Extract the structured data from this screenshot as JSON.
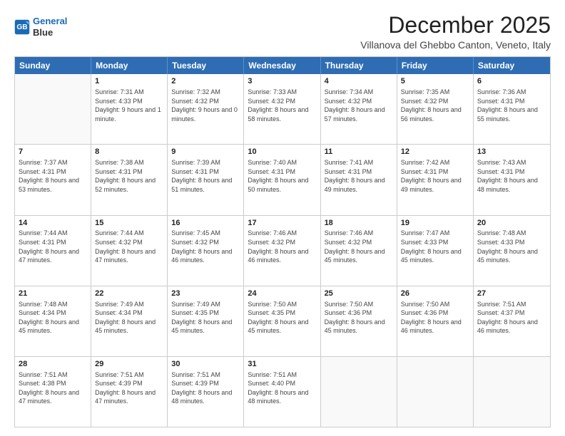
{
  "logo": {
    "line1": "General",
    "line2": "Blue"
  },
  "title": "December 2025",
  "location": "Villanova del Ghebbo Canton, Veneto, Italy",
  "header_days": [
    "Sunday",
    "Monday",
    "Tuesday",
    "Wednesday",
    "Thursday",
    "Friday",
    "Saturday"
  ],
  "weeks": [
    [
      {
        "day": "",
        "sunrise": "",
        "sunset": "",
        "daylight": ""
      },
      {
        "day": "1",
        "sunrise": "Sunrise: 7:31 AM",
        "sunset": "Sunset: 4:33 PM",
        "daylight": "Daylight: 9 hours and 1 minute."
      },
      {
        "day": "2",
        "sunrise": "Sunrise: 7:32 AM",
        "sunset": "Sunset: 4:32 PM",
        "daylight": "Daylight: 9 hours and 0 minutes."
      },
      {
        "day": "3",
        "sunrise": "Sunrise: 7:33 AM",
        "sunset": "Sunset: 4:32 PM",
        "daylight": "Daylight: 8 hours and 58 minutes."
      },
      {
        "day": "4",
        "sunrise": "Sunrise: 7:34 AM",
        "sunset": "Sunset: 4:32 PM",
        "daylight": "Daylight: 8 hours and 57 minutes."
      },
      {
        "day": "5",
        "sunrise": "Sunrise: 7:35 AM",
        "sunset": "Sunset: 4:32 PM",
        "daylight": "Daylight: 8 hours and 56 minutes."
      },
      {
        "day": "6",
        "sunrise": "Sunrise: 7:36 AM",
        "sunset": "Sunset: 4:31 PM",
        "daylight": "Daylight: 8 hours and 55 minutes."
      }
    ],
    [
      {
        "day": "7",
        "sunrise": "Sunrise: 7:37 AM",
        "sunset": "Sunset: 4:31 PM",
        "daylight": "Daylight: 8 hours and 53 minutes."
      },
      {
        "day": "8",
        "sunrise": "Sunrise: 7:38 AM",
        "sunset": "Sunset: 4:31 PM",
        "daylight": "Daylight: 8 hours and 52 minutes."
      },
      {
        "day": "9",
        "sunrise": "Sunrise: 7:39 AM",
        "sunset": "Sunset: 4:31 PM",
        "daylight": "Daylight: 8 hours and 51 minutes."
      },
      {
        "day": "10",
        "sunrise": "Sunrise: 7:40 AM",
        "sunset": "Sunset: 4:31 PM",
        "daylight": "Daylight: 8 hours and 50 minutes."
      },
      {
        "day": "11",
        "sunrise": "Sunrise: 7:41 AM",
        "sunset": "Sunset: 4:31 PM",
        "daylight": "Daylight: 8 hours and 49 minutes."
      },
      {
        "day": "12",
        "sunrise": "Sunrise: 7:42 AM",
        "sunset": "Sunset: 4:31 PM",
        "daylight": "Daylight: 8 hours and 49 minutes."
      },
      {
        "day": "13",
        "sunrise": "Sunrise: 7:43 AM",
        "sunset": "Sunset: 4:31 PM",
        "daylight": "Daylight: 8 hours and 48 minutes."
      }
    ],
    [
      {
        "day": "14",
        "sunrise": "Sunrise: 7:44 AM",
        "sunset": "Sunset: 4:31 PM",
        "daylight": "Daylight: 8 hours and 47 minutes."
      },
      {
        "day": "15",
        "sunrise": "Sunrise: 7:44 AM",
        "sunset": "Sunset: 4:32 PM",
        "daylight": "Daylight: 8 hours and 47 minutes."
      },
      {
        "day": "16",
        "sunrise": "Sunrise: 7:45 AM",
        "sunset": "Sunset: 4:32 PM",
        "daylight": "Daylight: 8 hours and 46 minutes."
      },
      {
        "day": "17",
        "sunrise": "Sunrise: 7:46 AM",
        "sunset": "Sunset: 4:32 PM",
        "daylight": "Daylight: 8 hours and 46 minutes."
      },
      {
        "day": "18",
        "sunrise": "Sunrise: 7:46 AM",
        "sunset": "Sunset: 4:32 PM",
        "daylight": "Daylight: 8 hours and 45 minutes."
      },
      {
        "day": "19",
        "sunrise": "Sunrise: 7:47 AM",
        "sunset": "Sunset: 4:33 PM",
        "daylight": "Daylight: 8 hours and 45 minutes."
      },
      {
        "day": "20",
        "sunrise": "Sunrise: 7:48 AM",
        "sunset": "Sunset: 4:33 PM",
        "daylight": "Daylight: 8 hours and 45 minutes."
      }
    ],
    [
      {
        "day": "21",
        "sunrise": "Sunrise: 7:48 AM",
        "sunset": "Sunset: 4:34 PM",
        "daylight": "Daylight: 8 hours and 45 minutes."
      },
      {
        "day": "22",
        "sunrise": "Sunrise: 7:49 AM",
        "sunset": "Sunset: 4:34 PM",
        "daylight": "Daylight: 8 hours and 45 minutes."
      },
      {
        "day": "23",
        "sunrise": "Sunrise: 7:49 AM",
        "sunset": "Sunset: 4:35 PM",
        "daylight": "Daylight: 8 hours and 45 minutes."
      },
      {
        "day": "24",
        "sunrise": "Sunrise: 7:50 AM",
        "sunset": "Sunset: 4:35 PM",
        "daylight": "Daylight: 8 hours and 45 minutes."
      },
      {
        "day": "25",
        "sunrise": "Sunrise: 7:50 AM",
        "sunset": "Sunset: 4:36 PM",
        "daylight": "Daylight: 8 hours and 45 minutes."
      },
      {
        "day": "26",
        "sunrise": "Sunrise: 7:50 AM",
        "sunset": "Sunset: 4:36 PM",
        "daylight": "Daylight: 8 hours and 46 minutes."
      },
      {
        "day": "27",
        "sunrise": "Sunrise: 7:51 AM",
        "sunset": "Sunset: 4:37 PM",
        "daylight": "Daylight: 8 hours and 46 minutes."
      }
    ],
    [
      {
        "day": "28",
        "sunrise": "Sunrise: 7:51 AM",
        "sunset": "Sunset: 4:38 PM",
        "daylight": "Daylight: 8 hours and 47 minutes."
      },
      {
        "day": "29",
        "sunrise": "Sunrise: 7:51 AM",
        "sunset": "Sunset: 4:39 PM",
        "daylight": "Daylight: 8 hours and 47 minutes."
      },
      {
        "day": "30",
        "sunrise": "Sunrise: 7:51 AM",
        "sunset": "Sunset: 4:39 PM",
        "daylight": "Daylight: 8 hours and 48 minutes."
      },
      {
        "day": "31",
        "sunrise": "Sunrise: 7:51 AM",
        "sunset": "Sunset: 4:40 PM",
        "daylight": "Daylight: 8 hours and 48 minutes."
      },
      {
        "day": "",
        "sunrise": "",
        "sunset": "",
        "daylight": ""
      },
      {
        "day": "",
        "sunrise": "",
        "sunset": "",
        "daylight": ""
      },
      {
        "day": "",
        "sunrise": "",
        "sunset": "",
        "daylight": ""
      }
    ]
  ]
}
